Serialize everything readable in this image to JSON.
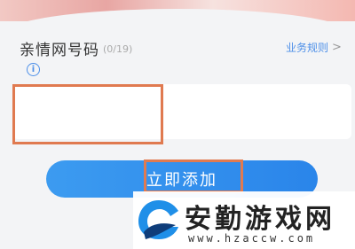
{
  "form": {
    "field_label": "亲情网号码",
    "counter": "(0/19)",
    "rules_link": "业务规则",
    "rules_chevron": ">",
    "info_icon": "i",
    "phone_value": ""
  },
  "actions": {
    "add_button": "立即添加"
  },
  "watermark": {
    "site_name": "安勤游戏网",
    "site_url": "www.hzaccw.com"
  },
  "colors": {
    "accent_blue": "#2a85ea",
    "highlight": "#e07a50"
  }
}
